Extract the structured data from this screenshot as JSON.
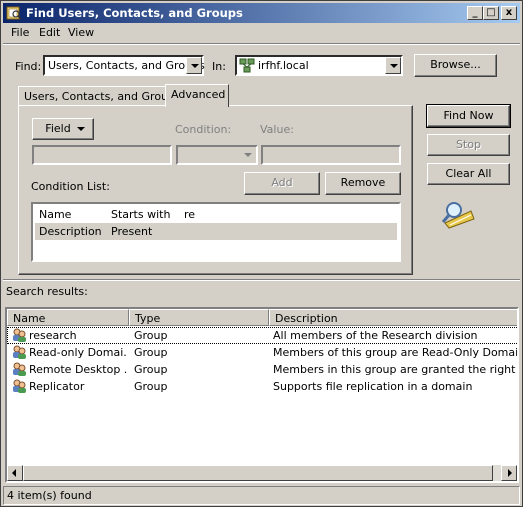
{
  "window": {
    "title": "Find Users, Contacts, and Groups",
    "controls": {
      "minimize": "_",
      "maximize": "□",
      "close": "x"
    }
  },
  "menu": {
    "items": [
      "File",
      "Edit",
      "View"
    ]
  },
  "find_row": {
    "find_label": "Find:",
    "find_value": "Users, Contacts, and Groups",
    "in_label": "In:",
    "in_value": "irfhf.local",
    "browse_label": "Browse..."
  },
  "tabs": [
    {
      "label": "Users, Contacts, and Groups",
      "active": false
    },
    {
      "label": "Advanced",
      "active": true
    }
  ],
  "advanced": {
    "field_button": "Field",
    "condition_label": "Condition:",
    "value_label": "Value:",
    "condition_list_label": "Condition List:",
    "add_label": "Add",
    "remove_label": "Remove",
    "conditions": [
      {
        "field": "Name",
        "condition": "Starts with",
        "value": "re",
        "selected": false
      },
      {
        "field": "Description",
        "condition": "Present",
        "value": "",
        "selected": true
      }
    ]
  },
  "side_buttons": {
    "find_now": "Find Now",
    "stop": "Stop",
    "clear_all": "Clear All"
  },
  "results": {
    "label": "Search results:",
    "columns": [
      "Name",
      "Type",
      "Description"
    ],
    "rows": [
      {
        "name": "research",
        "type": "Group",
        "description": "All members of the Research division"
      },
      {
        "name": "Read-only Domai...",
        "type": "Group",
        "description": "Members of this group are Read-Only Domain Contr"
      },
      {
        "name": "Remote Desktop ...",
        "type": "Group",
        "description": "Members in this group are granted the right to logor"
      },
      {
        "name": "Replicator",
        "type": "Group",
        "description": "Supports file replication in a domain"
      }
    ]
  },
  "status": {
    "text": "4 item(s) found"
  }
}
